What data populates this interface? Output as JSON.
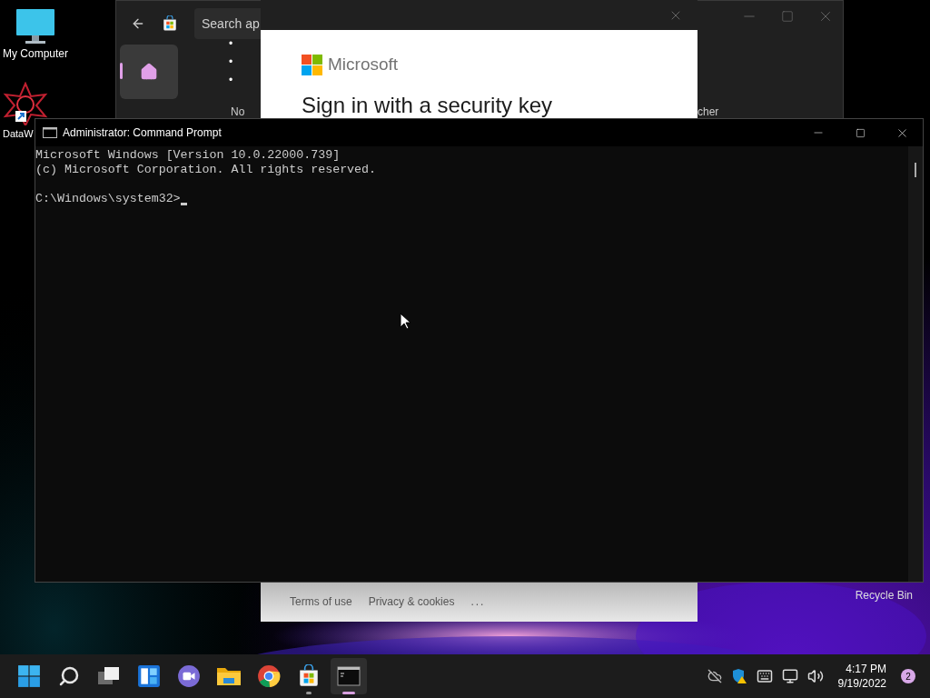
{
  "desktop_icons": [
    {
      "kind": "computer",
      "label": "My Computer"
    },
    {
      "kind": "shortcut",
      "label": "DataW"
    }
  ],
  "recycle_bin": {
    "label": "Recycle Bin"
  },
  "store_window": {
    "search_placeholder": "Search ap",
    "nav": [
      {
        "kind": "home",
        "selected": true
      }
    ],
    "bullets": [
      "•",
      "•",
      "•"
    ],
    "partial_texts": [
      "No",
      "cher"
    ]
  },
  "signin_dialog": {
    "brand": "Microsoft",
    "heading": "Sign in with a security key",
    "footer_links": [
      "Terms of use",
      "Privacy & cookies"
    ],
    "more": "..."
  },
  "cmd_window": {
    "title": "Administrator: Command Prompt",
    "lines": [
      "Microsoft Windows [Version 10.0.22000.739]",
      "(c) Microsoft Corporation. All rights reserved.",
      "C:\\Windows\\system32>"
    ]
  },
  "taskbar": {
    "apps": [
      {
        "kind": "start",
        "running": false,
        "selected": false
      },
      {
        "kind": "search",
        "running": false,
        "selected": false
      },
      {
        "kind": "taskview",
        "running": false,
        "selected": false
      },
      {
        "kind": "widgets",
        "running": false,
        "selected": false
      },
      {
        "kind": "chat",
        "running": false,
        "selected": false
      },
      {
        "kind": "explorer",
        "running": false,
        "selected": false
      },
      {
        "kind": "chrome",
        "running": false,
        "selected": false
      },
      {
        "kind": "store",
        "running": true,
        "selected": false
      },
      {
        "kind": "terminal",
        "running": true,
        "selected": true
      }
    ],
    "time": "4:17 PM",
    "date": "9/19/2022",
    "notifications": "2"
  }
}
